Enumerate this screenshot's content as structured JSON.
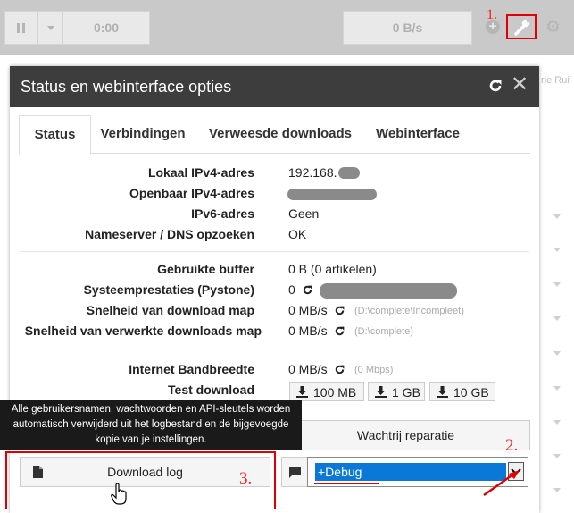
{
  "toolbar": {
    "time": "0:00",
    "speed": "0 B/s"
  },
  "annotations": {
    "one": "1.",
    "two": "2.",
    "three": "3."
  },
  "background": {
    "fragment": "rie Rui"
  },
  "modal": {
    "title": "Status en webinterface opties",
    "tabs": [
      "Status",
      "Verbindingen",
      "Verweesde downloads",
      "Webinterface"
    ]
  },
  "status": {
    "ipv4_local": {
      "label": "Lokaal IPv4-adres",
      "value": "192.168."
    },
    "ipv4_public": {
      "label": "Openbaar IPv4-adres"
    },
    "ipv6": {
      "label": "IPv6-adres",
      "value": "Geen"
    },
    "dns": {
      "label": "Nameserver / DNS opzoeken",
      "value": "OK"
    },
    "buffer": {
      "label": "Gebruikte buffer",
      "value": "0 B (0 artikelen)"
    },
    "pystone": {
      "label": "Systeemprestaties (Pystone)",
      "value": "0"
    },
    "dl_speed": {
      "label": "Snelheid van download map",
      "value": "0 MB/s",
      "path": "(D:\\complete\\Incompleet)"
    },
    "done_speed": {
      "label": "Snelheid van verwerkte downloads map",
      "value": "0 MB/s",
      "path": "(D:\\complete)"
    },
    "bandwidth": {
      "label": "Internet Bandbreedte",
      "value": "0 MB/s",
      "sub": "(0 Mbps)"
    },
    "test": {
      "label": "Test download",
      "buttons": [
        "100 MB",
        "1 GB",
        "10 GB"
      ]
    }
  },
  "tooltip": {
    "line1": "Alle gebruikersnamen, wachtwoorden en API-sleutels worden",
    "line2": "automatisch verwijderd uit het logbestand en de bijgevoegde",
    "line3": "kopie van je instellingen."
  },
  "actions": {
    "repair": "Wachtrij reparatie",
    "download_log": "Download log",
    "log_level": "+Debug"
  },
  "colors": {
    "header": "#3d3d3d",
    "annotation": "#e00000",
    "selection": "#0a78d7"
  }
}
